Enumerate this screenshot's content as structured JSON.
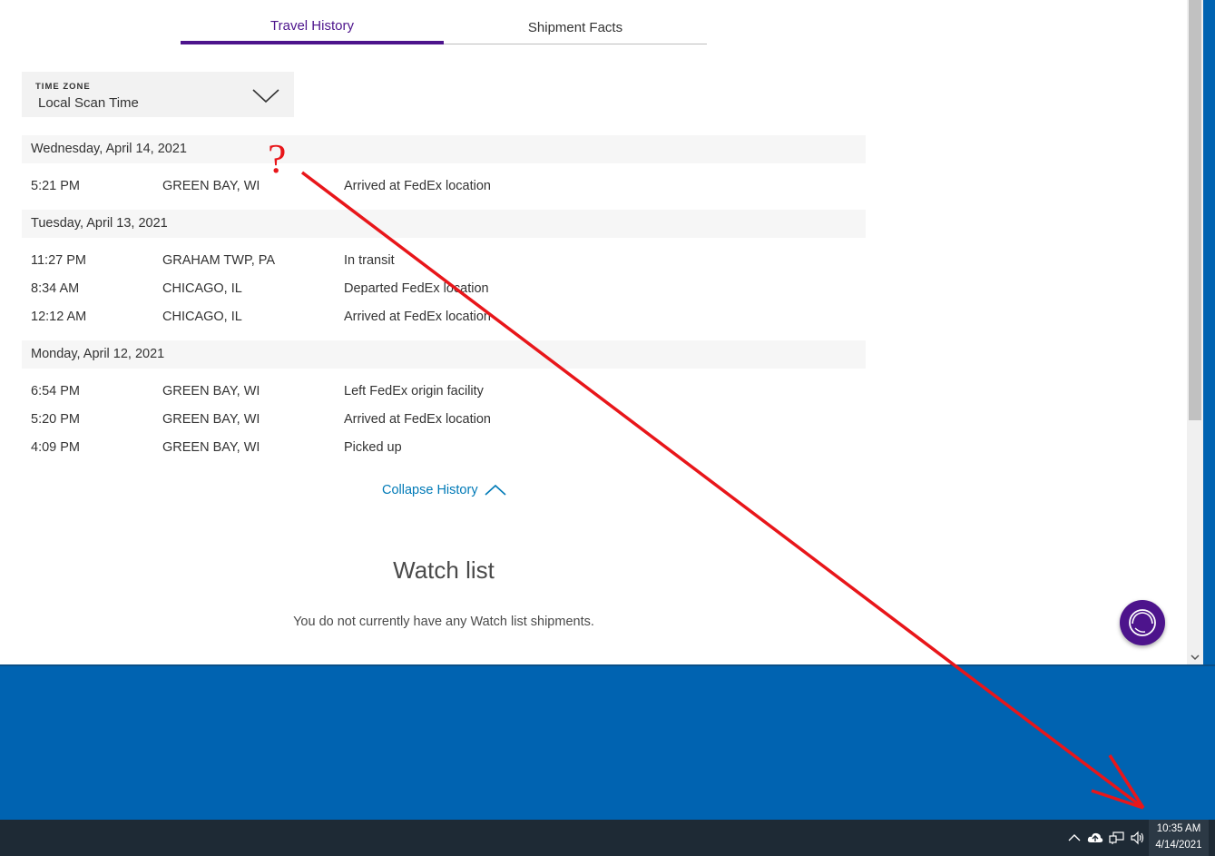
{
  "tabs": [
    {
      "label": "Travel History",
      "active": true
    },
    {
      "label": "Shipment Facts",
      "active": false
    }
  ],
  "timezone": {
    "label": "TIME ZONE",
    "value": "Local Scan Time"
  },
  "history": [
    {
      "date": "Wednesday, April 14, 2021",
      "events": [
        {
          "time": "5:21 PM",
          "location": "GREEN BAY, WI",
          "status": "Arrived at FedEx location"
        }
      ]
    },
    {
      "date": "Tuesday, April 13, 2021",
      "events": [
        {
          "time": "11:27 PM",
          "location": "GRAHAM TWP, PA",
          "status": "In transit"
        },
        {
          "time": "8:34 AM",
          "location": "CHICAGO, IL",
          "status": "Departed FedEx location"
        },
        {
          "time": "12:12 AM",
          "location": "CHICAGO, IL",
          "status": "Arrived at FedEx location"
        }
      ]
    },
    {
      "date": "Monday, April 12, 2021",
      "events": [
        {
          "time": "6:54 PM",
          "location": "GREEN BAY, WI",
          "status": "Left FedEx origin facility"
        },
        {
          "time": "5:20 PM",
          "location": "GREEN BAY, WI",
          "status": "Arrived at FedEx location"
        },
        {
          "time": "4:09 PM",
          "location": "GREEN BAY, WI",
          "status": "Picked up"
        }
      ]
    }
  ],
  "collapse_label": "Collapse History",
  "watchlist": {
    "title": "Watch list",
    "message": "You do not currently have any Watch list shipments."
  },
  "taskbar": {
    "time": "10:35 AM",
    "date": "4/14/2021"
  },
  "annotation": {
    "mark": "?",
    "color": "#e8161a"
  },
  "colors": {
    "brand_purple": "#4d148c",
    "link_blue": "#007ab7",
    "desktop_blue": "#0063b1"
  }
}
